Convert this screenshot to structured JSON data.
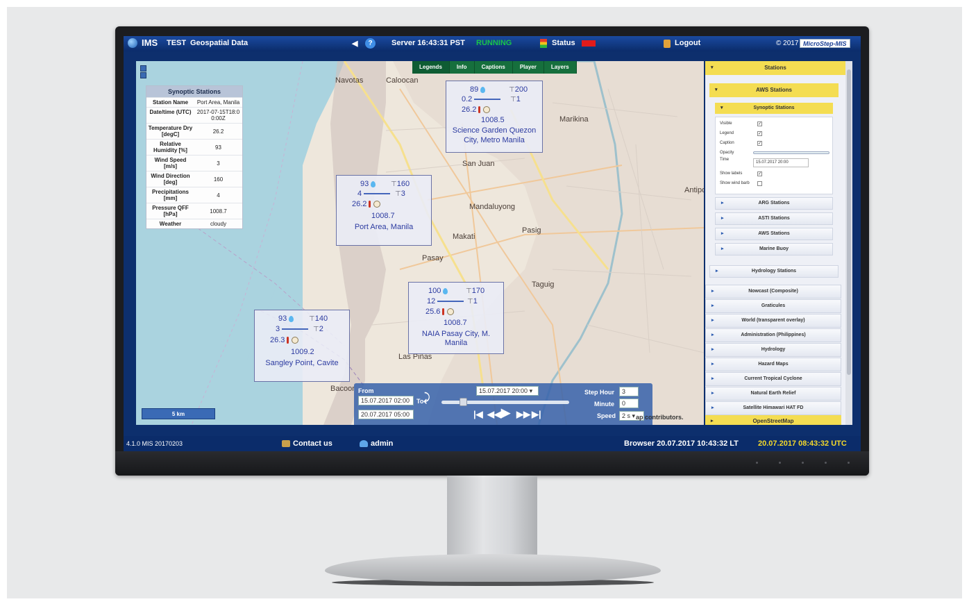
{
  "app": {
    "brand": "IMS",
    "env": "TEST",
    "subtitle": "Geospatial Data",
    "server": "Server 16:43:31 PST",
    "running": "RUNNING",
    "status_label": "Status",
    "logout_label": "Logout",
    "copyright": "© 2017",
    "logo_text": "MicroStep-MIS"
  },
  "map_tabs": [
    "Legends",
    "Info",
    "Captions",
    "Player",
    "Layers"
  ],
  "map_labels": [
    "Navotas",
    "Caloocan",
    "San Juan",
    "Mandaluyong",
    "Makati",
    "Pasig",
    "Pasay",
    "Taguig",
    "Marikina",
    "Las Piñas",
    "Bacoor",
    "Antipolo"
  ],
  "synoptic": {
    "title": "Synoptic Stations",
    "rows": [
      {
        "k": "Station Name",
        "v": "Port Area, Manila"
      },
      {
        "k": "Date/time (UTC)",
        "v": "2017-07-15T18:00:00Z"
      },
      {
        "k": "Temperature Dry [degC]",
        "v": "26.2"
      },
      {
        "k": "Relative Humidity [%]",
        "v": "93"
      },
      {
        "k": "Wind Speed [m/s]",
        "v": "3"
      },
      {
        "k": "Wind Direction [deg]",
        "v": "160"
      },
      {
        "k": "Precipitations [mm]",
        "v": "4"
      },
      {
        "k": "Pressure QFF [hPa]",
        "v": "1008.7"
      },
      {
        "k": "Weather",
        "v": "cloudy"
      }
    ]
  },
  "stations": [
    {
      "humidity": "89",
      "dir": "200",
      "precip": "0.2",
      "speed": "1",
      "temp": "26.2",
      "pressure": "1008.5",
      "name": "Science Garden Quezon City, Metro Manila"
    },
    {
      "humidity": "93",
      "dir": "160",
      "precip": "4",
      "speed": "3",
      "temp": "26.2",
      "pressure": "1008.7",
      "name": "Port Area, Manila"
    },
    {
      "humidity": "100",
      "dir": "170",
      "precip": "12",
      "speed": "1",
      "temp": "25.6",
      "pressure": "1008.7",
      "name": "NAIA Pasay City, M. Manila"
    },
    {
      "humidity": "93",
      "dir": "140",
      "precip": "3",
      "speed": "2",
      "temp": "26.3",
      "pressure": "1009.2",
      "name": "Sangley Point, Cavite"
    }
  ],
  "player": {
    "from_label": "From",
    "to_label": "To",
    "from_date": "15.07.2017 02:00",
    "to_date": "20.07.2017 05:00",
    "current": "15.07.2017 20:00",
    "step_hour_label": "Step Hour",
    "step_hour": "3",
    "minute_label": "Minute",
    "minute": "0",
    "speed_label": "Speed",
    "speed": "2 s",
    "progress": 0.15
  },
  "scale_label": "5 km",
  "attribution": "ap contributors.",
  "panel": {
    "stations": "Stations",
    "aws_stations": "AWS Stations",
    "synoptic_stations": "Synoptic Stations",
    "props": {
      "visible": "Visible",
      "legend": "Legend",
      "caption": "Caption",
      "opacity": "Opacity",
      "time": "Time",
      "time_value": "15.07.2017 20:00",
      "show_labels": "Show labels",
      "show_wind_barb": "Show wind barb"
    },
    "sub_items": [
      "ARG Stations",
      "ASTI Stations",
      "AWS Stations",
      "Marine Buoy"
    ],
    "hydrology_stations": "Hydrology Stations",
    "layers": [
      "Nowcast (Composite)",
      "Graticules",
      "World (transparent overlay)",
      "Administration (Philippines)",
      "Hydrology",
      "Hazard Maps",
      "Current Tropical Cyclone",
      "Natural Earth Relief",
      "Satellite Himawari HAT FD"
    ],
    "osm": "OpenStreetMap"
  },
  "footer": {
    "version": "4.1.0 MIS 20170203",
    "contact": "Contact us",
    "user": "admin",
    "browser_time": "Browser 20.07.2017 10:43:32 LT",
    "utc_time": "20.07.2017 08:43:32 UTC"
  },
  "colors": {
    "topbar": "#0b2c6a",
    "accent_yellow": "#f4dd52",
    "tab_green": "#166f3d",
    "running_green": "#19c54a",
    "status_red": "#e11b1b"
  }
}
